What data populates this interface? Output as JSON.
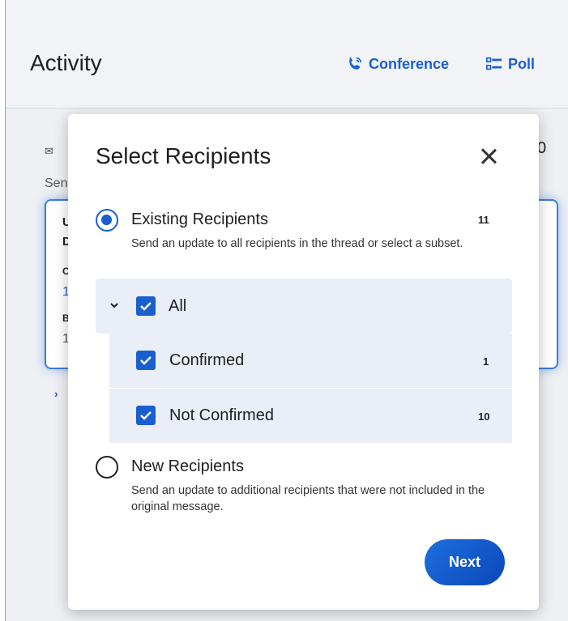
{
  "app": {
    "title": "Activity",
    "conference_label": "Conference",
    "poll_label": "Poll",
    "bg_partial": {
      "text1": "Sen",
      "letter_u": "U",
      "letter_d": "D",
      "letter_o": "O",
      "blue_1": "1",
      "letter_b": "B",
      "gray_1": "1",
      "right_0": "0"
    }
  },
  "modal": {
    "title": "Select Recipients",
    "existing": {
      "label": "Existing Recipients",
      "count": "11",
      "description": "Send an update to all recipients in the thread or select a subset."
    },
    "groups": {
      "all_label": "All",
      "confirmed_label": "Confirmed",
      "confirmed_count": "1",
      "not_confirmed_label": "Not Confirmed",
      "not_confirmed_count": "10"
    },
    "new": {
      "label": "New Recipients",
      "description": "Send an update to additional recipients that were not included in the original message."
    },
    "next_label": "Next"
  },
  "colors": {
    "accent": "#1a5fd0",
    "row_bg": "#e9eef7"
  }
}
